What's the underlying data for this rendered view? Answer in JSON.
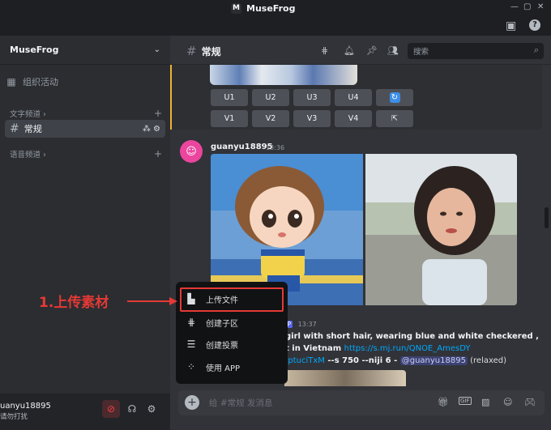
{
  "app": {
    "title": "MuseFrog",
    "logo_letter": "M"
  },
  "window_controls": {
    "minimize": "—",
    "maximize": "▢",
    "close": "✕"
  },
  "server": {
    "name": "MuseFrog"
  },
  "sidebar": {
    "events_label": "组织活动",
    "text_category": "文字频道 ›",
    "voice_category": "语音频道 ›",
    "active_channel": "常规"
  },
  "user": {
    "name": "uanyu18895",
    "status": "请勿打扰"
  },
  "channel": {
    "name": "常规"
  },
  "search": {
    "placeholder": "搜索"
  },
  "buttons": {
    "row1": [
      "U1",
      "U2",
      "U3",
      "U4"
    ],
    "row2": [
      "V1",
      "V2",
      "V3",
      "V4"
    ]
  },
  "message": {
    "author": "guanyu18895",
    "timestamp": "13:36"
  },
  "message2": {
    "badge": "APP",
    "timestamp": "13:37",
    "line1": "girl with short hair, wearing blue and white checkered ,",
    "line2_prefix": "t in Vietnam ",
    "line2_link": "https://s.mj.run/QNOE_AmesDY",
    "line3_link": "/ptuciTxM",
    "line3_text": " --s 750 --niji 6 - ",
    "line3_mention": "@guanyu18895",
    "line3_suffix": " (relaxed)"
  },
  "popup": {
    "items": [
      {
        "label": "上传文件",
        "icon": "upload-file-icon"
      },
      {
        "label": "创建子区",
        "icon": "thread-icon"
      },
      {
        "label": "创建投票",
        "icon": "poll-icon"
      },
      {
        "label": "使用 APP",
        "icon": "app-icon"
      }
    ]
  },
  "composer": {
    "placeholder": "给 #常规 发消息"
  },
  "annotation": {
    "label": "1.上传素材",
    "color": "#e53935"
  },
  "colors": {
    "accent": "#5865f2",
    "highlight": "#e53935",
    "avatar": "#eb459e",
    "link": "#00a8fc"
  }
}
